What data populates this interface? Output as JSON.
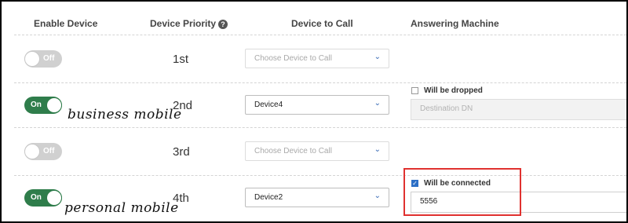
{
  "headers": {
    "enable_device": "Enable Device",
    "device_priority": "Device Priority",
    "help_glyph": "?",
    "device_to_call": "Device to Call",
    "answering_machine": "Answering Machine"
  },
  "rows": [
    {
      "toggle_label": "Off",
      "priority": "1st",
      "device": "Choose Device to Call",
      "chevron": "⌄"
    },
    {
      "toggle_label": "On",
      "annotation": "business mobile",
      "priority": "2nd",
      "device": "Device4",
      "chevron": "⌄",
      "am_checkbox_label": "Will be dropped",
      "am_field_placeholder": "Destination DN"
    },
    {
      "toggle_label": "Off",
      "priority": "3rd",
      "device": "Choose Device to Call",
      "chevron": "⌄"
    },
    {
      "toggle_label": "On",
      "annotation": "personal mobile",
      "priority": "4th",
      "device": "Device2",
      "chevron": "⌄",
      "am_checkbox_label": "Will be connected",
      "am_checkmark": "✓",
      "am_field_value": "5556"
    }
  ],
  "colors": {
    "toggle_on": "#2f7d4b",
    "toggle_off": "#d0d0d0",
    "checkbox_checked": "#2c6fc6",
    "highlight_box": "#e0312f",
    "chevron": "#3568b5"
  }
}
